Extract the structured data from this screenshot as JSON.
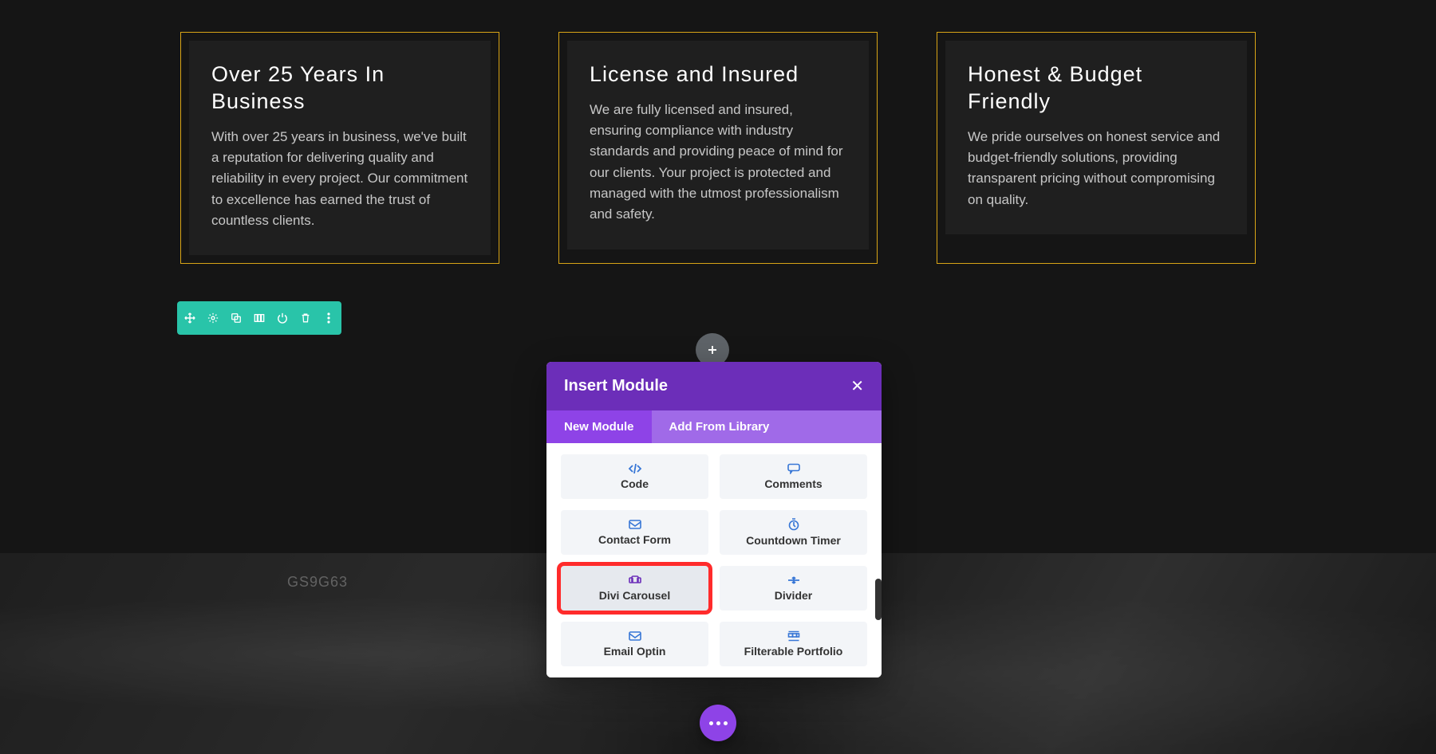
{
  "cards": [
    {
      "title": "Over 25 Years In Business",
      "body": "With over 25 years in business, we've built a reputation for delivering quality and reliability in every project. Our commitment to excellence has earned the trust of countless clients."
    },
    {
      "title": "License and Insured",
      "body": "We are fully licensed and insured, ensuring compliance with industry standards and providing peace of mind for our clients. Your project is protected and managed with the utmost professionalism and safety."
    },
    {
      "title": "Honest & Budget Friendly",
      "body": "We pride ourselves on honest service and budget-friendly solutions, providing transparent pricing without compromising on quality."
    }
  ],
  "toolbar_icons": [
    "move",
    "settings",
    "duplicate",
    "columns",
    "power",
    "trash",
    "more"
  ],
  "modal": {
    "title": "Insert Module",
    "tabs": {
      "new": "New Module",
      "library": "Add From Library"
    },
    "modules": [
      {
        "icon": "code",
        "label": "Code"
      },
      {
        "icon": "comments",
        "label": "Comments"
      },
      {
        "icon": "contact",
        "label": "Contact Form"
      },
      {
        "icon": "countdown",
        "label": "Countdown Timer"
      },
      {
        "icon": "carousel",
        "label": "Divi Carousel",
        "highlighted": true
      },
      {
        "icon": "divider",
        "label": "Divider"
      },
      {
        "icon": "email",
        "label": "Email Optin"
      },
      {
        "icon": "portfolio",
        "label": "Filterable Portfolio"
      }
    ]
  },
  "bg_label": "GS9G63",
  "colors": {
    "accent_gold": "#d8a416",
    "toolbar_teal": "#29c4a9",
    "modal_purple": "#6c2eb9",
    "tab_active": "#8e43e7",
    "highlight_red": "#ff2b2b",
    "icon_blue": "#3776d6"
  }
}
